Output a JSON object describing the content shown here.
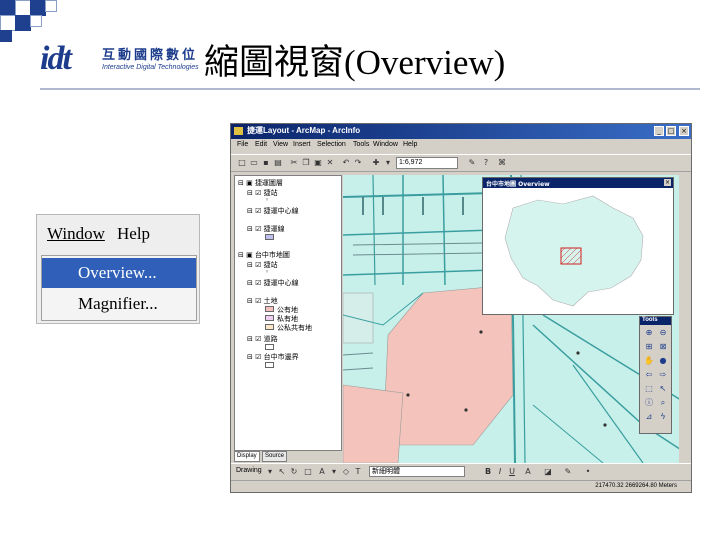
{
  "slide": {
    "title": "縮圖視窗(Overview)",
    "logo_mark": "idt",
    "logo_cn": "互動國際數位",
    "logo_en": "Interactive Digital Technologies"
  },
  "menu": {
    "bar": [
      "Window",
      "Help"
    ],
    "items": [
      {
        "label": "Overview...",
        "selected": true
      },
      {
        "label": "Magnifier...",
        "selected": false
      }
    ]
  },
  "arcmap": {
    "title": "捷運Layout - ArcMap - ArcInfo",
    "menus": [
      "File",
      "Edit",
      "View",
      "Insert",
      "Selection",
      "Tools",
      "Window",
      "Help"
    ],
    "scale": "1:6,972",
    "toc": {
      "frames": [
        {
          "name": "捷運圖層",
          "layers": [
            {
              "name": "捷站",
              "swatch": "#e8e8e8"
            },
            {
              "name": "捷運中心線",
              "swatch": "#ffffff"
            },
            {
              "name": "捷運線",
              "swatch": "#c0c0f0"
            }
          ]
        },
        {
          "name": "台中市地圖",
          "layers": [
            {
              "name": "捷站",
              "swatch": "#ffffff"
            },
            {
              "name": "捷運中心線",
              "swatch": "#ffffff"
            },
            {
              "name": "土地",
              "swatch": "#ffffff"
            },
            {
              "name": "道路",
              "swatch": "#ffffff"
            },
            {
              "name": "台中市邊界",
              "swatch": "#ffffff"
            }
          ],
          "legend": [
            {
              "label": "公有地",
              "color": "#f4c0c0"
            },
            {
              "label": "私有地",
              "color": "#f0d0f0"
            },
            {
              "label": "公私共有地",
              "color": "#fce8c8"
            }
          ]
        }
      ],
      "tabs": [
        "Display",
        "Source"
      ]
    },
    "overview_title": "台中市地圖 Overview",
    "tools_title": "Tools",
    "draw_label": "Drawing",
    "font_value": "新細明體",
    "status_text": "217470.32 2669264.80 Meters",
    "colors": {
      "map_bg": "#c8f0ea",
      "land": "#f4c4bc",
      "road": "#3a9ea0",
      "overview_fill": "#d6f4ee"
    }
  }
}
